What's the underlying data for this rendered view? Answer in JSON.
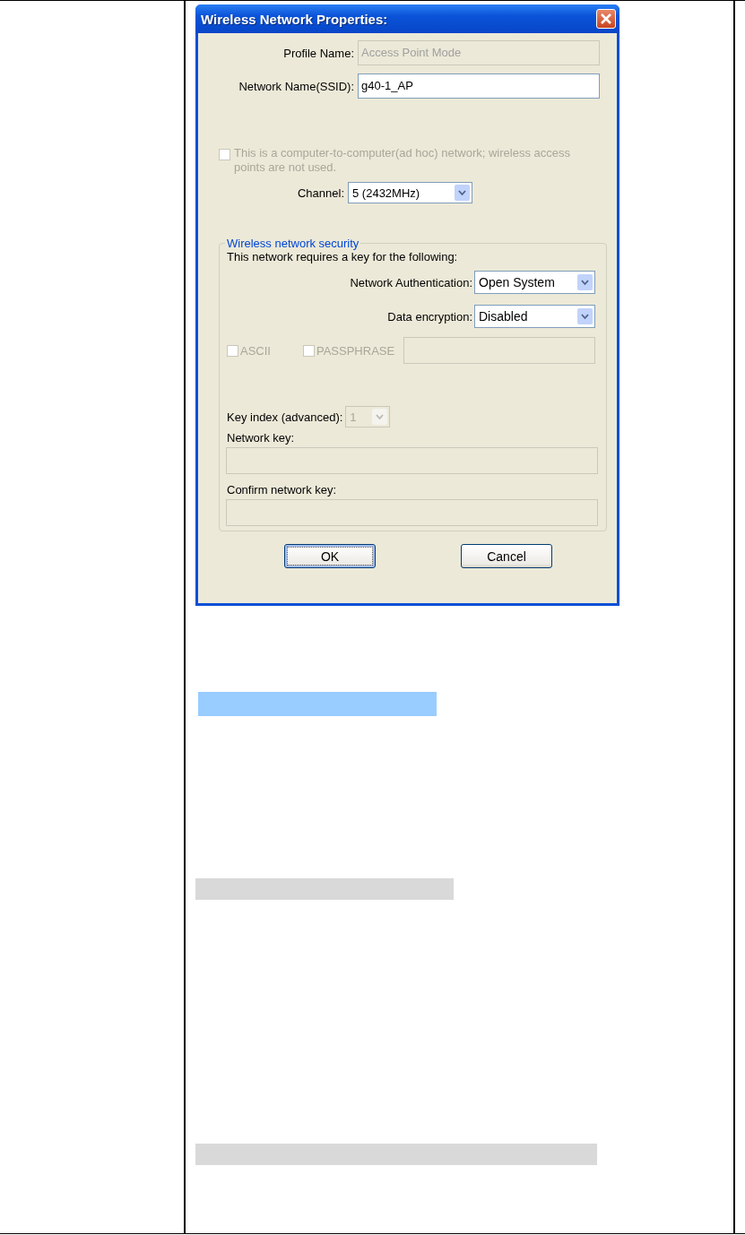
{
  "window": {
    "title": "Wireless Network Properties:"
  },
  "fields": [
    {
      "label": "Profile Name:",
      "value": "Access Point Mode",
      "disabled": true
    },
    {
      "label": "Network Name(SSID):",
      "value": "g40-1_AP",
      "disabled": false
    }
  ],
  "adhoc": {
    "label": "This is a computer-to-computer(ad hoc) network; wireless access points are not used.",
    "checked": false,
    "disabled": true
  },
  "channel": {
    "label": "Channel:",
    "value": "5  (2432MHz)",
    "disabled": false
  },
  "security": {
    "legend": "Wireless network security",
    "intro": "This network requires a key for the following:",
    "selects": [
      {
        "label": "Network Authentication:",
        "value": "Open System",
        "disabled": false
      },
      {
        "label": "Data encryption:",
        "value": "Disabled",
        "disabled": false
      }
    ],
    "checkboxes": [
      {
        "label": "ASCII",
        "checked": false,
        "disabled": true
      },
      {
        "label": "PASSPHRASE",
        "checked": false,
        "disabled": true
      }
    ],
    "passphrase": {
      "disabled": true
    },
    "key_index": {
      "label": "Key index (advanced):",
      "value": "1",
      "disabled": true
    },
    "keys": [
      {
        "label": "Network key:",
        "disabled": true
      },
      {
        "label": "Confirm network key:",
        "disabled": true
      }
    ]
  },
  "buttons": [
    {
      "label": "OK",
      "default": true
    },
    {
      "label": "Cancel",
      "default": false
    }
  ],
  "highlights": [
    {
      "color": "#99ccff"
    },
    {
      "color": "#d9d9d9"
    },
    {
      "color": "#d9d9d9"
    }
  ]
}
